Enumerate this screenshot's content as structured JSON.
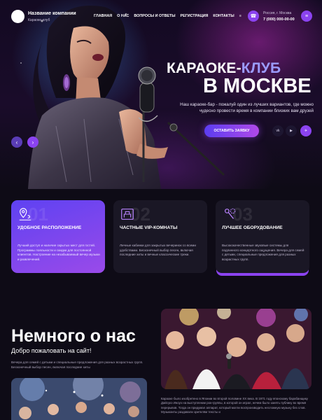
{
  "header": {
    "logo_title": "Название компании",
    "logo_sub": "Караоке-клуб",
    "nav": [
      "ГЛАВНАЯ",
      "О НАС",
      "ВОПРОСЫ И ОТВЕТЫ",
      "РЕГИСТРАЦИЯ",
      "КОНТАКТЫ"
    ],
    "nav_more": "≡",
    "location": "Россия, г. Москва",
    "phone": "7 (000) 000-00-00",
    "phone_icon": "phone-icon",
    "menu_icon": "menu-icon"
  },
  "hero": {
    "title_part1": "КАРАОКЕ-",
    "title_part2": "КЛУБ",
    "title_line2": "В МОСКВЕ",
    "text": "Наш караоке-бар - пожалуй один из лучших вариантов, где можно чудесно провести время в компании близких вам друзей",
    "cta": "ОСТАВИТЬ ЗАЯВКУ",
    "social": [
      "vk",
      "youtube",
      "telegram"
    ],
    "social_labels": [
      "vk",
      "▶",
      "✈"
    ],
    "arrow_left": "‹",
    "arrow_right": "›"
  },
  "features": [
    {
      "num": "01",
      "icon": "map-pin-icon",
      "title": "УДОБНОЕ РАСПОЛОЖЕНИЕ",
      "text": "Лучший доступ и наличие скрытых мест для гостей. Программы лояльности и скидки для постоянной клиентов. Настроение на незабываемый вечер музыки и развлечений."
    },
    {
      "num": "02",
      "icon": "vip-room-icon",
      "title": "ЧАСТНЫЕ VIP-КОМНАТЫ",
      "text": "Личные кабинки для закрытых вечеринок со всеми удобствами. Бесконечный выбор песен, включая последние хиты и вечные классические треки."
    },
    {
      "num": "03",
      "icon": "microphone-gear-icon",
      "title": "ЛУЧШЕЕ ОБОРУДОВАНИЕ",
      "text": "Высококачественные звуковые системы для подлинного концертного ощущения. Вечера для семей с детьми, специальные предложения для разных возрастных групп."
    }
  ],
  "about": {
    "title": "Немного о нас",
    "subtitle": "Добро пожаловать на сайт!",
    "text": "Вечера для семей с детьми и специальные предложения для разных возрастных групп. Бесконечный выбор песен, включая последние хиты",
    "text2": "Караоке было изобретено в Японии во второй половине XX века. В 1971 году японскому барабанщику Дайсукэ Иноуэ на выступлении рок-группы, в которой он играл, нечем было занять публику во время перерывов. Тогда он придумал аппарат, который могли воспроизводить несложную музыку без слов. Музыканты раздавали зрителям тексты и"
  },
  "colors": {
    "accent": "#8b43f0",
    "accent_blue": "#5e42f2",
    "background": "#0e0b16",
    "card": "#1a1725"
  }
}
